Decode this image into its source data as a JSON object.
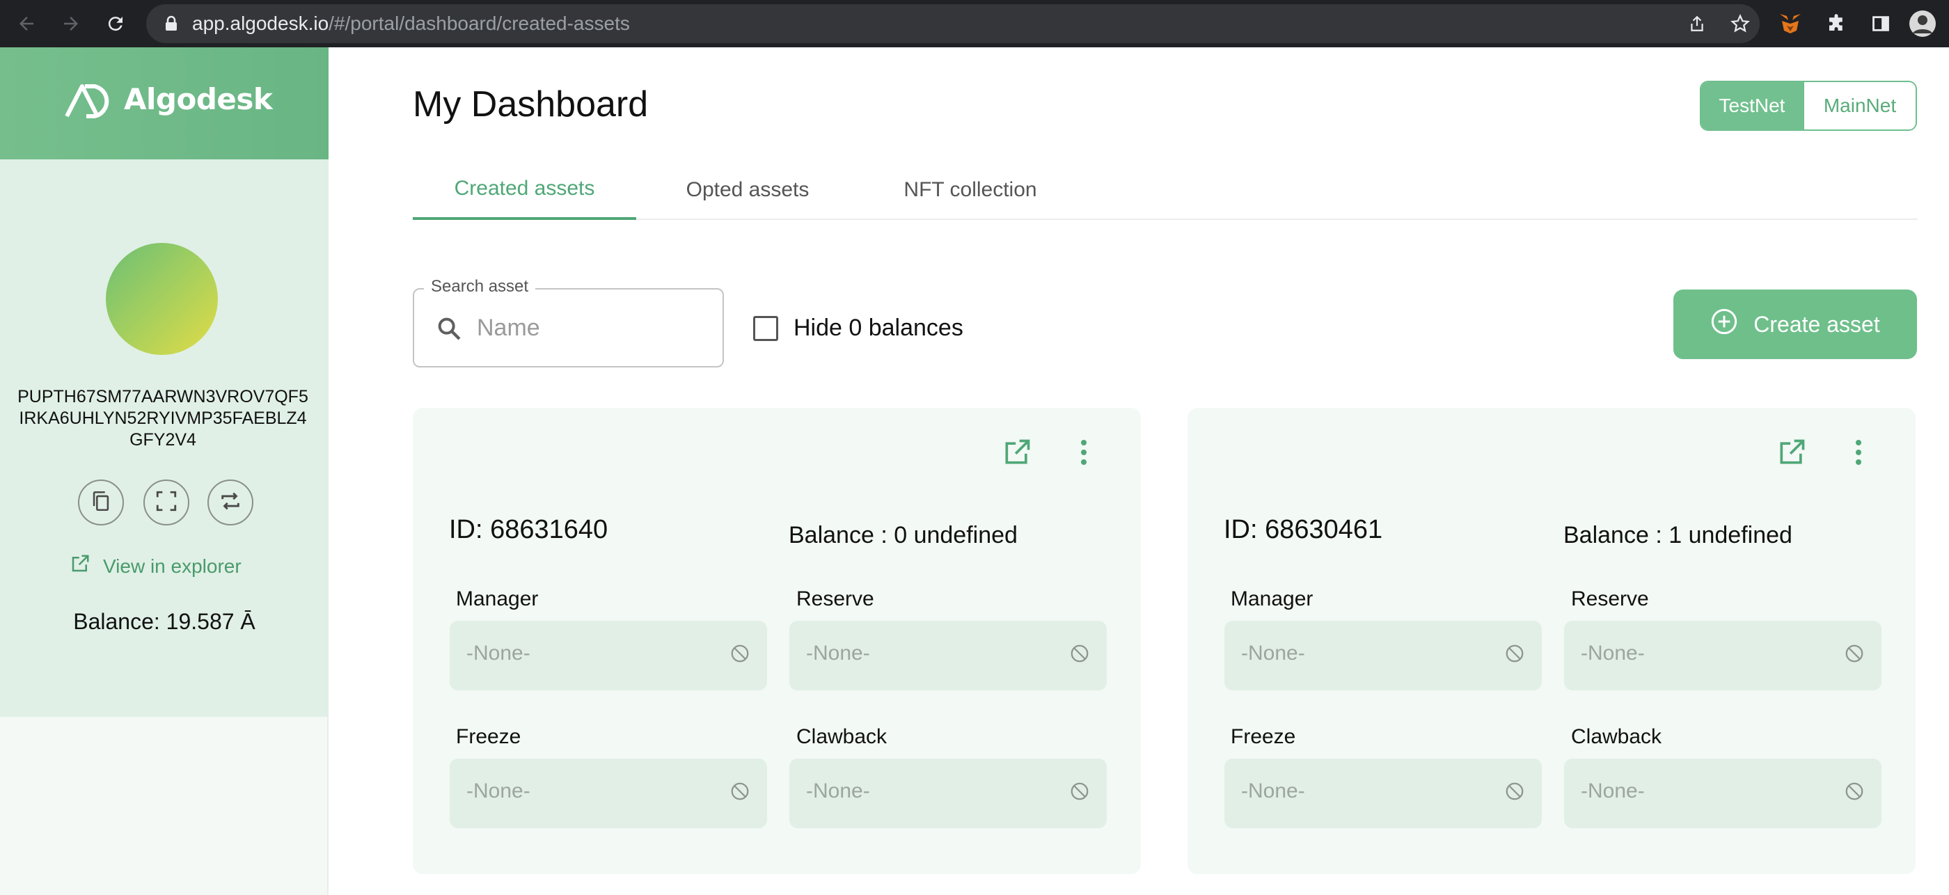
{
  "browser": {
    "url_host": "app.algodesk.io",
    "url_path": "/#/portal/dashboard/created-assets"
  },
  "sidebar": {
    "brand": "Algodesk",
    "address": "PUPTH67SM77AARWN3VROV7QF5IRKA6UHLYN52RYIVMP35FAEBLZ4GFY2V4",
    "explorer_label": "View in explorer",
    "balance": "Balance: 19.587 Ā"
  },
  "header": {
    "title": "My Dashboard",
    "networks": [
      "TestNet",
      "MainNet"
    ],
    "active_network": "TestNet"
  },
  "tabs": [
    {
      "label": "Created assets",
      "active": true
    },
    {
      "label": "Opted assets",
      "active": false
    },
    {
      "label": "NFT collection",
      "active": false
    }
  ],
  "toolbar": {
    "search_label": "Search asset",
    "search_placeholder": "Name",
    "search_value": "",
    "hide_zero_label": "Hide 0 balances",
    "hide_zero_checked": false,
    "create_label": "Create asset"
  },
  "assets": [
    {
      "id": "ID: 68631640",
      "balance": "Balance : 0 undefined",
      "fields": [
        {
          "label": "Manager",
          "value": "-None-"
        },
        {
          "label": "Reserve",
          "value": "-None-"
        },
        {
          "label": "Freeze",
          "value": "-None-"
        },
        {
          "label": "Clawback",
          "value": "-None-"
        }
      ]
    },
    {
      "id": "ID: 68630461",
      "balance": "Balance : 1 undefined",
      "fields": [
        {
          "label": "Manager",
          "value": "-None-"
        },
        {
          "label": "Reserve",
          "value": "-None-"
        },
        {
          "label": "Freeze",
          "value": "-None-"
        },
        {
          "label": "Clawback",
          "value": "-None-"
        }
      ]
    }
  ],
  "colors": {
    "brand_green": "#6fbf8e",
    "active_tab": "#4fa777",
    "panel_bg": "#e0f0e6",
    "card_bg": "#f3f9f5"
  }
}
